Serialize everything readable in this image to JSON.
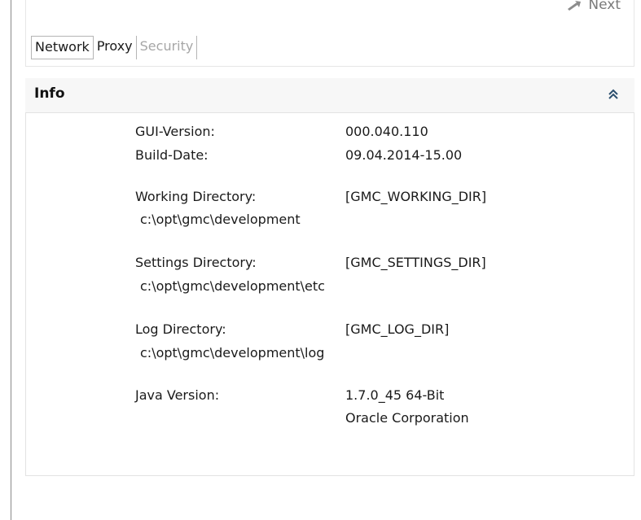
{
  "nav": {
    "next_label": "Next"
  },
  "tabs": [
    {
      "label": "Network",
      "state": "active"
    },
    {
      "label": "Proxy",
      "state": "normal"
    },
    {
      "label": "Security",
      "state": "disabled"
    }
  ],
  "info": {
    "title": "Info",
    "collapse_icon": "chevron-double-up-icon",
    "gui_version_label": "GUI-Version:",
    "gui_version_value": "000.040.110",
    "build_date_label": "Build-Date:",
    "build_date_value": "09.04.2014-15.00",
    "working_dir_label": "Working Directory:",
    "working_dir_var": "[GMC_WORKING_DIR]",
    "working_dir_path": "c:\\opt\\gmc\\development",
    "settings_dir_label": "Settings Directory:",
    "settings_dir_var": "[GMC_SETTINGS_DIR]",
    "settings_dir_path": "c:\\opt\\gmc\\development\\etc",
    "log_dir_label": "Log Directory:",
    "log_dir_var": "[GMC_LOG_DIR]",
    "log_dir_path": "c:\\opt\\gmc\\development\\log",
    "java_version_label": "Java Version:",
    "java_version_value": "1.7.0_45 64-Bit",
    "java_vendor_value": "Oracle Corporation"
  },
  "colors": {
    "disabled_text": "#a6a6a6",
    "header_bg": "#f7f7f7",
    "border": "#e3e3e3"
  }
}
